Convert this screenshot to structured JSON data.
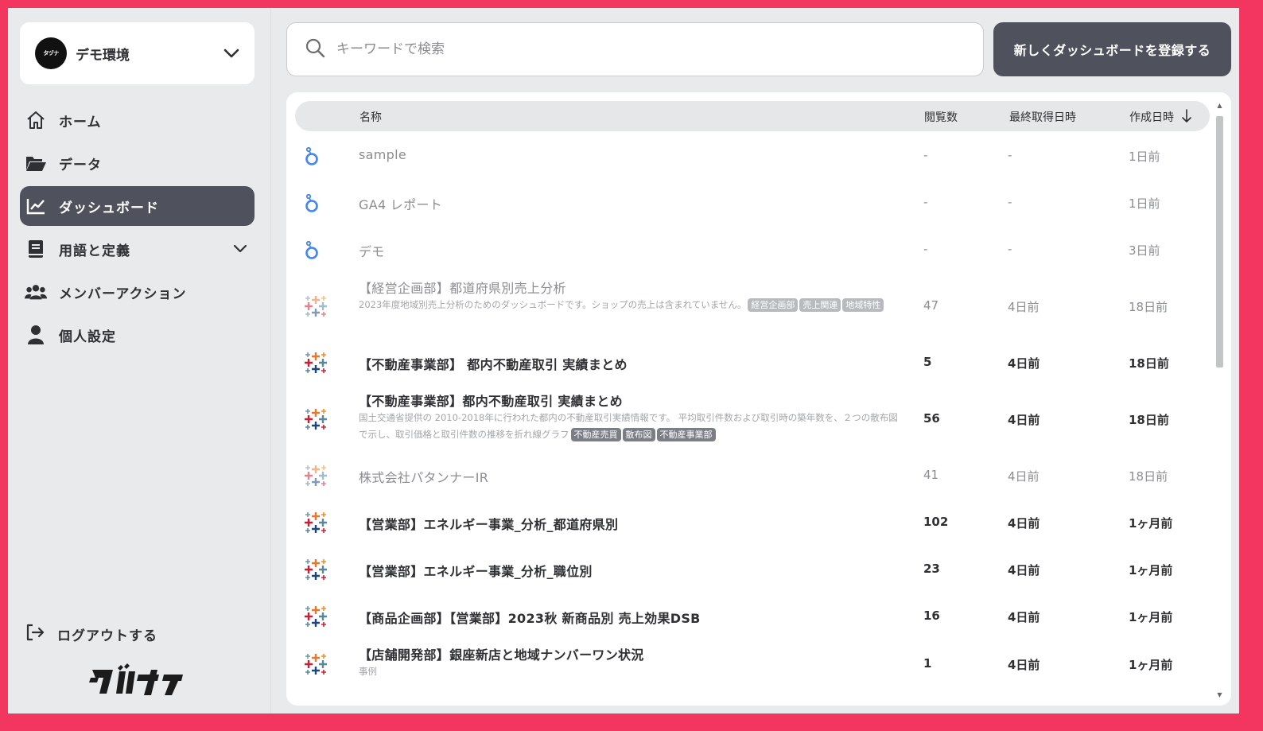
{
  "sidebar": {
    "tenant_name": "デモ環境",
    "tenant_logo_text": "タヅナ",
    "nav": [
      {
        "label": "ホーム",
        "icon": "home-icon"
      },
      {
        "label": "データ",
        "icon": "folder-icon"
      },
      {
        "label": "ダッシュボード",
        "icon": "chart-line-icon",
        "active": true
      },
      {
        "label": "用語と定義",
        "icon": "book-icon",
        "expandable": true
      },
      {
        "label": "メンバーアクション",
        "icon": "users-icon"
      },
      {
        "label": "個人設定",
        "icon": "user-icon"
      }
    ],
    "logout_label": "ログアウトする",
    "brand": "タヅナ"
  },
  "search": {
    "placeholder": "キーワードで検索",
    "value": ""
  },
  "register_button": "新しくダッシュボードを登録する",
  "table": {
    "headers": {
      "name": "名称",
      "views": "閲覧数",
      "last_fetched": "最終取得日時",
      "created": "作成日時"
    },
    "rows": [
      {
        "source": "looker-studio",
        "title": "sample",
        "desc": "",
        "tags": [],
        "views": "-",
        "fetched": "-",
        "created": "1日前",
        "style": "muted"
      },
      {
        "source": "looker-studio",
        "title": "GA4 レポート",
        "desc": "",
        "tags": [],
        "views": "-",
        "fetched": "-",
        "created": "1日前",
        "style": "muted"
      },
      {
        "source": "looker-studio",
        "title": "デモ",
        "desc": "",
        "tags": [],
        "views": "-",
        "fetched": "-",
        "created": "3日前",
        "style": "muted"
      },
      {
        "source": "tableau",
        "title": "【経営企画部】都道府県別売上分析",
        "desc": "2023年度地域別売上分析のためのダッシュボードです。ショップの売上は含まれていません。",
        "tags": [
          "経営企画部",
          "売上関連",
          "地域特性"
        ],
        "views": "47",
        "fetched": "4日前",
        "created": "18日前",
        "style": "muted"
      },
      {
        "source": "tableau",
        "title": "【不動産事業部】 都内不動産取引 実績まとめ",
        "desc": "",
        "tags": [],
        "views": "5",
        "fetched": "4日前",
        "created": "18日前",
        "style": "bold"
      },
      {
        "source": "tableau",
        "title": "【不動産事業部】都内不動産取引 実績まとめ",
        "desc": "国土交通省提供の 2010-2018年に行われた都内の不動産取引実績情報です。 平均取引件数および取引時の築年数を、２つの散布図で示し、取引価格と取引件数の推移を折れ線グラフ",
        "tags": [
          "不動産売買",
          "散布図",
          "不動産事業部"
        ],
        "views": "56",
        "fetched": "4日前",
        "created": "18日前",
        "style": "bold"
      },
      {
        "source": "tableau",
        "title": "株式会社パタンナーIR",
        "desc": "",
        "tags": [],
        "views": "41",
        "fetched": "4日前",
        "created": "18日前",
        "style": "muted"
      },
      {
        "source": "tableau",
        "title": "【営業部】エネルギー事業_分析_都道府県別",
        "desc": "",
        "tags": [],
        "views": "102",
        "fetched": "4日前",
        "created": "1ヶ月前",
        "style": "bold"
      },
      {
        "source": "tableau",
        "title": "【営業部】エネルギー事業_分析_職位別",
        "desc": "",
        "tags": [],
        "views": "23",
        "fetched": "4日前",
        "created": "1ヶ月前",
        "style": "bold"
      },
      {
        "source": "tableau",
        "title": "【商品企画部】【営業部】2023秋 新商品別 売上効果DSB",
        "desc": "",
        "tags": [],
        "views": "16",
        "fetched": "4日前",
        "created": "1ヶ月前",
        "style": "bold"
      },
      {
        "source": "tableau",
        "title": "【店舗開発部】銀座新店と地域ナンバーワン状況",
        "desc": "事例",
        "tags": [],
        "views": "1",
        "fetched": "4日前",
        "created": "1ヶ月前",
        "style": "bold"
      }
    ]
  },
  "colors": {
    "frame": "#f3365f",
    "active_nav": "#4f525c",
    "button": "#4f525c",
    "looker": "#4285f4",
    "tableau_orange": "#e8762c",
    "tableau_blue": "#1f457e",
    "tableau_red": "#c72035",
    "tableau_teal": "#5b879b",
    "tableau_purple": "#7199a6"
  }
}
